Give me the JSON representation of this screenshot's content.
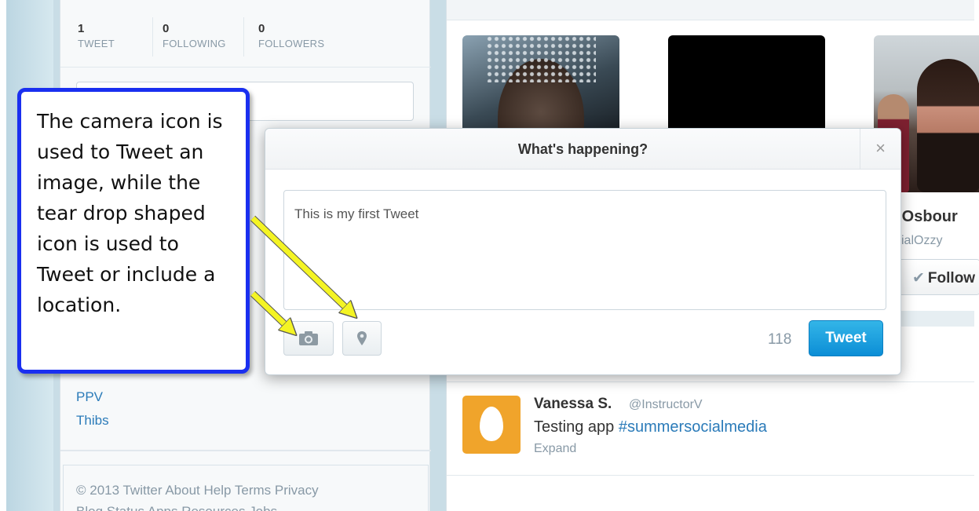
{
  "profile_stats": [
    {
      "count": "1",
      "label": "TWEET"
    },
    {
      "count": "0",
      "label": "FOLLOWING"
    },
    {
      "count": "0",
      "label": "FOLLOWERS"
    }
  ],
  "trends": [
    "PPV",
    "Thibs"
  ],
  "footer": {
    "line1": "© 2013 Twitter  About  Help  Terms  Privacy",
    "line2": "Blog  Status  Apps  Resources  Jobs"
  },
  "who_to_follow": {
    "name": "y Osbour",
    "handle": "ficialOzzy",
    "follow_label": "Follow"
  },
  "timeline_tweet": {
    "name": "Vanessa S.",
    "handle": "@InstructorV",
    "text_prefix": "Testing app ",
    "hashtag": "#summersocialmedia",
    "expand_label": "Expand"
  },
  "compose_modal": {
    "title": "What's happening?",
    "close_glyph": "×",
    "tweet_text": "This is my first Tweet",
    "char_count": "118",
    "tweet_button": "Tweet",
    "icons": [
      "camera-icon",
      "location-pin-icon"
    ]
  },
  "callout": {
    "text": "The camera icon is used to Tweet an image, while the tear drop shaped icon is used to Tweet or include a location."
  },
  "colors": {
    "tweet_button": "#1b9de0",
    "link": "#2b7bb9",
    "callout_border": "#1a2ff0",
    "arrow": "#f4f424"
  }
}
